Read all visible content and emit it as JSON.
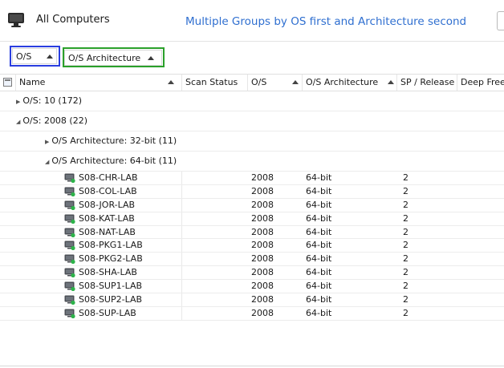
{
  "header": {
    "title": "All Computers",
    "subtitle": "Multiple Groups by OS first and Architecture second"
  },
  "group_panel": {
    "chips": [
      {
        "label": "O/S"
      },
      {
        "label": "O/S Architecture"
      }
    ]
  },
  "columns": [
    {
      "label": "Name"
    },
    {
      "label": "Scan Status"
    },
    {
      "label": "O/S"
    },
    {
      "label": "O/S Architecture"
    },
    {
      "label": "SP / Release"
    },
    {
      "label": "Deep Freez"
    }
  ],
  "groups": [
    {
      "text": "O/S: 10   (172)",
      "expanded": false
    },
    {
      "text": "O/S: 2008   (22)",
      "expanded": true
    },
    {
      "text": "O/S Architecture: 32-bit   (11)",
      "expanded": false
    },
    {
      "text": "O/S Architecture: 64-bit   (11)",
      "expanded": true
    }
  ],
  "computers": [
    {
      "name": "S08-CHR-LAB",
      "os": "2008",
      "arch": "64-bit",
      "sp": "2"
    },
    {
      "name": "S08-COL-LAB",
      "os": "2008",
      "arch": "64-bit",
      "sp": "2"
    },
    {
      "name": "S08-JOR-LAB",
      "os": "2008",
      "arch": "64-bit",
      "sp": "2"
    },
    {
      "name": "S08-KAT-LAB",
      "os": "2008",
      "arch": "64-bit",
      "sp": "2"
    },
    {
      "name": "S08-NAT-LAB",
      "os": "2008",
      "arch": "64-bit",
      "sp": "2"
    },
    {
      "name": "S08-PKG1-LAB",
      "os": "2008",
      "arch": "64-bit",
      "sp": "2"
    },
    {
      "name": "S08-PKG2-LAB",
      "os": "2008",
      "arch": "64-bit",
      "sp": "2"
    },
    {
      "name": "S08-SHA-LAB",
      "os": "2008",
      "arch": "64-bit",
      "sp": "2"
    },
    {
      "name": "S08-SUP1-LAB",
      "os": "2008",
      "arch": "64-bit",
      "sp": "2"
    },
    {
      "name": "S08-SUP2-LAB",
      "os": "2008",
      "arch": "64-bit",
      "sp": "2"
    },
    {
      "name": "S08-SUP-LAB",
      "os": "2008",
      "arch": "64-bit",
      "sp": "2"
    }
  ],
  "colors": {
    "subtitle": "#2f6fd0",
    "highlight_blue": "#2a3ee0",
    "highlight_green": "#2aa02a",
    "status_online": "#2db34a"
  }
}
